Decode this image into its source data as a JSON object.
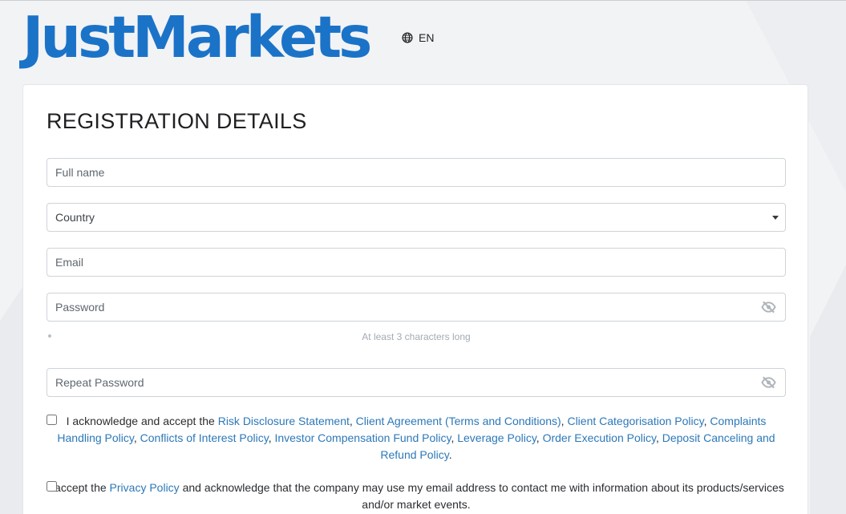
{
  "brand": {
    "name": "JustMarkets",
    "color": "#1b73c8"
  },
  "language": {
    "icon": "globe-icon",
    "label": "EN"
  },
  "form": {
    "title": "REGISTRATION DETAILS",
    "full_name": {
      "placeholder": "Full name"
    },
    "country": {
      "value": "Country",
      "icon": "caret-down-icon"
    },
    "email": {
      "placeholder": "Email"
    },
    "password": {
      "placeholder": "Password",
      "icon": "eye-slash-icon",
      "hint": "At least 3 characters long"
    },
    "repeat_password": {
      "placeholder": "Repeat Password",
      "icon": "eye-slash-icon"
    },
    "agreement": {
      "prefix": "I acknowledge and accept the ",
      "links": [
        "Risk Disclosure Statement",
        "Client Agreement (Terms and Conditions)",
        "Client Categorisation Policy",
        "Complaints Handling Policy",
        "Conflicts of Interest Policy",
        "Investor Compensation Fund Policy",
        "Leverage Policy",
        "Order Execution Policy",
        "Deposit Canceling and Refund Policy"
      ],
      "separator": ", ",
      "suffix": "."
    },
    "privacy": {
      "prefix": "I accept the ",
      "link": "Privacy Policy",
      "suffix": " and acknowledge that the company may use my email address to contact me with information about its products/services and/or market events."
    }
  },
  "colors": {
    "link": "#2c78b8",
    "background": "#f2f3f5",
    "card": "#ffffff"
  }
}
